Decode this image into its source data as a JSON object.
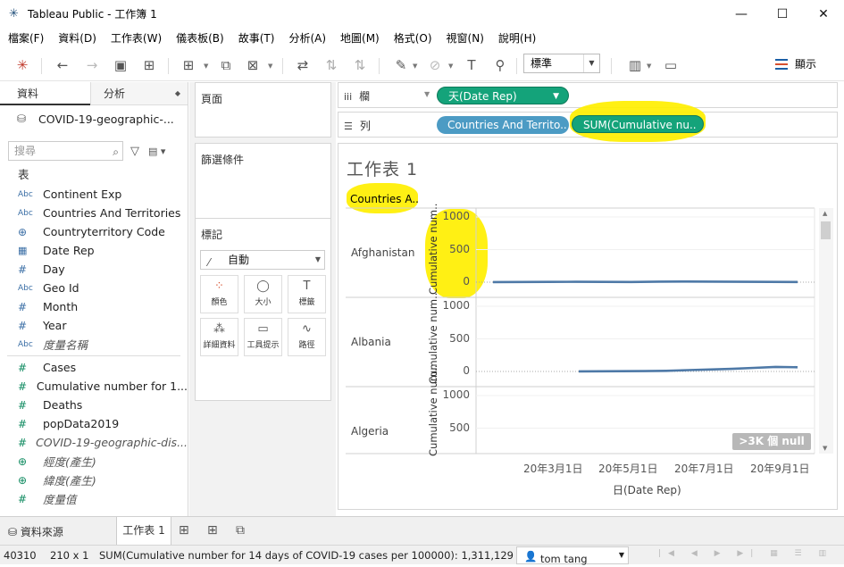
{
  "window": {
    "title": "Tableau Public - 工作簿 1",
    "minimize": "—",
    "maximize": "☐",
    "close": "✕"
  },
  "menu": [
    "檔案(F)",
    "資料(D)",
    "工作表(W)",
    "儀表板(B)",
    "故事(T)",
    "分析(A)",
    "地圖(M)",
    "格式(O)",
    "視窗(N)",
    "說明(H)"
  ],
  "toolbar": {
    "fit_value": "標準",
    "show_me": "顯示"
  },
  "data_pane": {
    "tab_data": "資料",
    "tab_analytics": "分析",
    "datasource": "COVID-19-geographic-...",
    "search_placeholder": "搜尋",
    "tables_label": "表",
    "dimensions": [
      {
        "type": "Abc",
        "name": "Continent Exp"
      },
      {
        "type": "Abc",
        "name": "Countries And Territories"
      },
      {
        "type": "⊕",
        "name": "Countryterritory Code"
      },
      {
        "type": "▦",
        "name": "Date Rep"
      },
      {
        "type": "#",
        "name": "Day"
      },
      {
        "type": "Abc",
        "name": "Geo Id"
      },
      {
        "type": "#",
        "name": "Month"
      },
      {
        "type": "#",
        "name": "Year"
      },
      {
        "type": "Abc",
        "name": "度量名稱"
      }
    ],
    "measures": [
      {
        "type": "#",
        "name": "Cases"
      },
      {
        "type": "#",
        "name": "Cumulative number for 1..."
      },
      {
        "type": "#",
        "name": "Deaths"
      },
      {
        "type": "#",
        "name": "popData2019"
      },
      {
        "type": "#",
        "name": "COVID-19-geographic-dis..."
      },
      {
        "type": "⊕",
        "name": "經度(產生)"
      },
      {
        "type": "⊕",
        "name": "緯度(產生)"
      },
      {
        "type": "#",
        "name": "度量值"
      }
    ]
  },
  "shelves": {
    "pages": "頁面",
    "filters": "篩選條件",
    "marks": "標記",
    "marks_type": "自動",
    "mark_buttons": [
      "顏色",
      "大小",
      "標籤",
      "詳細資料",
      "工具提示",
      "路徑"
    ],
    "columns_label": "欄",
    "rows_label": "列",
    "columns_pill": "天(Date Rep)",
    "rows_pill_1": "Countries And Territo..",
    "rows_pill_2": "SUM(Cumulative nu.."
  },
  "view": {
    "sheet_title": "工作表 1",
    "row_header": "Countries A..",
    "y_axis_title": "Cumulative num..",
    "y_ticks": [
      "1000",
      "500",
      "0"
    ],
    "countries": [
      "Afghanistan",
      "Albania",
      "Algeria"
    ],
    "x_ticks": [
      "20年3月1日",
      "20年5月1日",
      "20年7月1日",
      "20年9月1日"
    ],
    "x_label": "日(Date Rep)",
    "null_badge": ">3K 個 null"
  },
  "chart_data": {
    "type": "line",
    "title": "工作表 1",
    "xlabel": "日(Date Rep)",
    "ylabel": "Cumulative num..",
    "x_ticks": [
      "20年3月1日",
      "20年5月1日",
      "20年7月1日",
      "20年9月1日"
    ],
    "ylim": [
      0,
      1000
    ],
    "series": [
      {
        "name": "Afghanistan",
        "values": [
          2,
          3,
          4,
          5,
          4,
          3,
          8,
          10,
          8,
          5,
          4,
          3
        ]
      },
      {
        "name": "Albania",
        "values": [
          2,
          3,
          4,
          6,
          10,
          20,
          30,
          40,
          55,
          70,
          65
        ]
      }
    ],
    "color": "#4e79a7"
  },
  "tabs": {
    "datasource": "資料來源",
    "sheet": "工作表 1"
  },
  "status": {
    "marks": "40310",
    "dims": "210 x 1",
    "sum": "SUM(Cumulative number for 14 days of COVID-19 cases per 100000): 1,311,129",
    "user": "tom tang"
  }
}
